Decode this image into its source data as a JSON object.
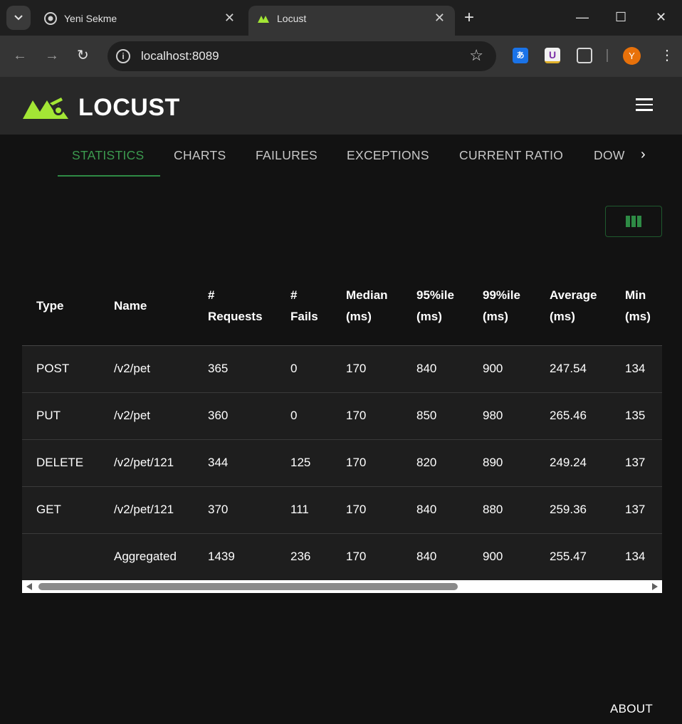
{
  "browser": {
    "tabs": [
      {
        "title": "Yeni Sekme",
        "icon": "chrome-icon"
      },
      {
        "title": "Locust",
        "icon": "locust-favicon"
      }
    ],
    "close_glyph": "✕",
    "new_tab_glyph": "+",
    "url": "localhost:8089",
    "avatar_letter": "Y",
    "window_controls": {
      "minimize": "—",
      "maximize": "☐",
      "close": "✕"
    }
  },
  "app": {
    "logo_text": "LOCUST",
    "brand_color": "#a3e635",
    "nav_tabs": [
      {
        "label": "STATISTICS",
        "active": true
      },
      {
        "label": "CHARTS"
      },
      {
        "label": "FAILURES"
      },
      {
        "label": "EXCEPTIONS"
      },
      {
        "label": "CURRENT RATIO"
      },
      {
        "label": "DOW"
      }
    ],
    "table": {
      "headers": [
        [
          "Type"
        ],
        [
          "Name"
        ],
        [
          "#",
          "Requests"
        ],
        [
          "#",
          "Fails"
        ],
        [
          "Median",
          "(ms)"
        ],
        [
          "95%ile",
          "(ms)"
        ],
        [
          "99%ile",
          "(ms)"
        ],
        [
          "Average",
          "(ms)"
        ],
        [
          "Min",
          "(ms)"
        ]
      ],
      "rows": [
        [
          "POST",
          "/v2/pet",
          "365",
          "0",
          "170",
          "840",
          "900",
          "247.54",
          "134"
        ],
        [
          "PUT",
          "/v2/pet",
          "360",
          "0",
          "170",
          "850",
          "980",
          "265.46",
          "135"
        ],
        [
          "DELETE",
          "/v2/pet/121",
          "344",
          "125",
          "170",
          "820",
          "890",
          "249.24",
          "137"
        ],
        [
          "GET",
          "/v2/pet/121",
          "370",
          "111",
          "170",
          "840",
          "880",
          "259.36",
          "137"
        ],
        [
          "",
          "Aggregated",
          "1439",
          "236",
          "170",
          "840",
          "900",
          "255.47",
          "134"
        ]
      ]
    },
    "footer_link": "ABOUT"
  }
}
